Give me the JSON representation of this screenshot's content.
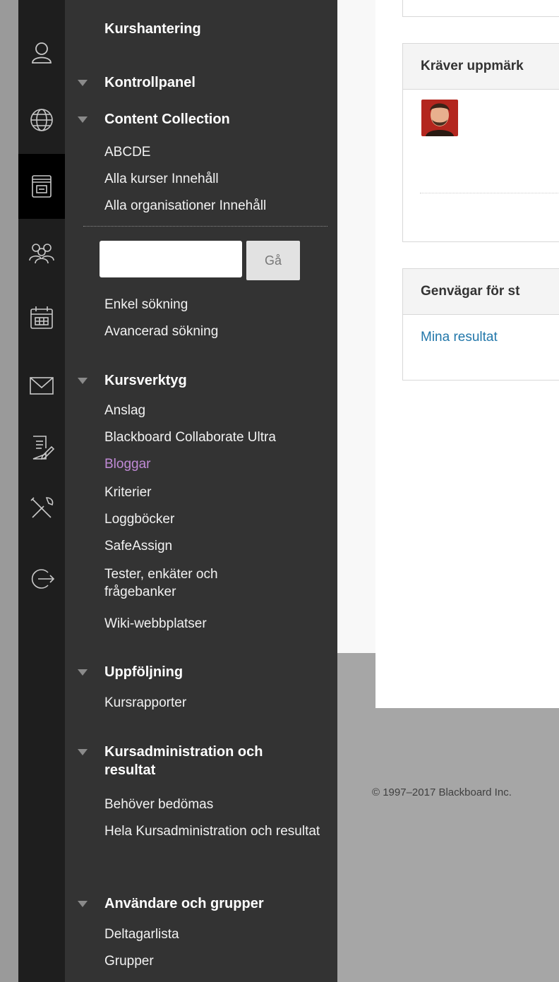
{
  "sidebar": {
    "title": "Kurshantering",
    "sections": {
      "kontrollpanel": "Kontrollpanel",
      "content_collection": "Content Collection",
      "kursverktyg": "Kursverktyg",
      "uppfoljning": "Uppföljning",
      "kursadmin": "Kursadministration och resultat",
      "anvandare": "Användare och grupper"
    },
    "content_collection_links": {
      "abcde": "ABCDE",
      "alla_kurser": "Alla kurser Innehåll",
      "alla_org": "Alla organisationer Innehåll"
    },
    "search": {
      "placeholder": "",
      "go_label": "Gå",
      "simple": "Enkel sökning",
      "advanced": "Avancerad sökning"
    },
    "kursverktyg_links": {
      "anslag": "Anslag",
      "collaborate": "Blackboard Collaborate Ultra",
      "bloggar": "Bloggar",
      "kriterier": "Kriterier",
      "loggbocker": "Loggböcker",
      "safeassign": "SafeAssign",
      "tester": "Tester, enkäter och frågebanker",
      "wiki": "Wiki-webbplatser"
    },
    "uppfoljning_links": {
      "kursrapporter": "Kursrapporter"
    },
    "kursadmin_links": {
      "behover": "Behöver bedömas",
      "hela": "Hela Kursadministration och resultat"
    },
    "anvandare_links": {
      "deltagarlista": "Deltagarlista",
      "grupper": "Grupper"
    }
  },
  "main": {
    "panel1_title": "Kräver uppmärk",
    "panel2_title": "Genvägar för st",
    "panel2_link": "Mina resultat"
  },
  "footer": {
    "copyright": "© 1997–2017 Blackboard Inc."
  },
  "colors": {
    "nav_bg": "#333333",
    "rail_bg": "#1e1e1e",
    "visited_link": "#c08ad6",
    "link_blue": "#2277aa"
  }
}
